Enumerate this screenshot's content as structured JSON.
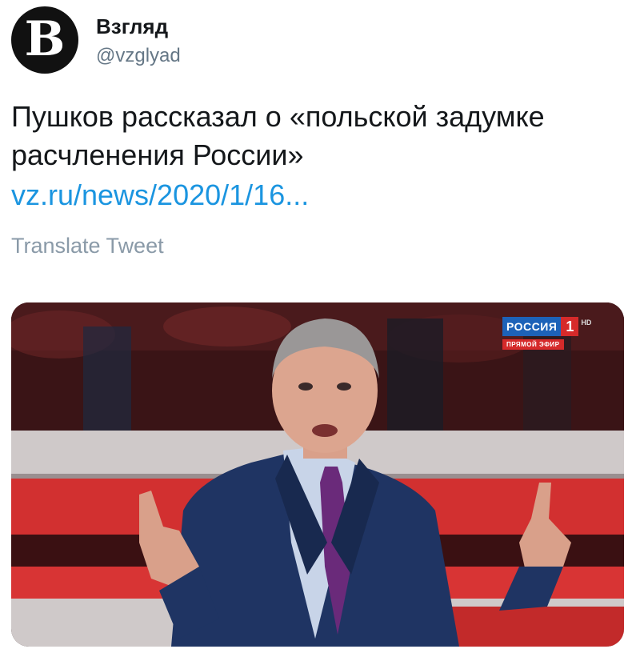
{
  "account": {
    "display_name": "Взгляд",
    "handle": "@vzglyad",
    "avatar_letter": "B",
    "avatar_icon": "vzglyad-logo-icon"
  },
  "tweet": {
    "text": "Пушков рассказал о «польской задумке расчленения России»",
    "link": "vz.ru/news/2020/1/16...",
    "translate_label": "Translate Tweet"
  },
  "media": {
    "channel_name": "РОССИЯ",
    "channel_number": "1",
    "channel_hd": "HD",
    "live_label": "ПРЯМОЙ ЭФИР"
  },
  "colors": {
    "link": "#1b95e0",
    "secondary_text": "#657786",
    "studio_red": "#d62a2a"
  }
}
